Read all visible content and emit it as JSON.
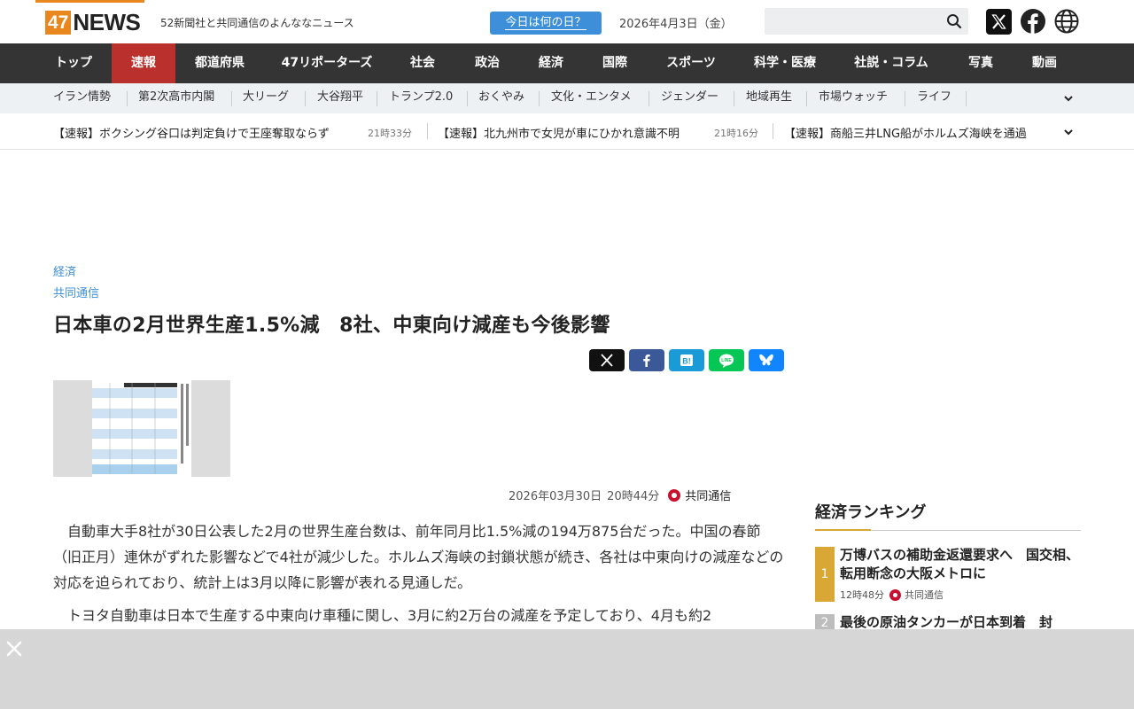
{
  "header": {
    "logo_num": "47",
    "logo_word": "NEWS",
    "tagline": "52新聞社と共同通信のよんななニュース",
    "today_button": "今日は何の日？",
    "date": "2026年4月3日（金）",
    "search_placeholder": ""
  },
  "main_nav": [
    "トップ",
    "速報",
    "都道府県",
    "47リポーターズ",
    "社会",
    "政治",
    "経済",
    "国際",
    "スポーツ",
    "科学・医療",
    "社説・コラム",
    "写真",
    "動画"
  ],
  "topic_nav": [
    "イラン情勢",
    "第2次高市内閣",
    "大リーグ",
    "大谷翔平",
    "トランプ2.0",
    "おくやみ",
    "文化・エンタメ",
    "ジェンダー",
    "地域再生",
    "市場ウォッチ",
    "ライフ"
  ],
  "ticker": [
    {
      "text": "【速報】ボクシング谷口は判定負けで王座奪取ならず",
      "time": "21時33分"
    },
    {
      "text": "【速報】北九州市で女児が車にひかれ意識不明",
      "time": "21時16分"
    },
    {
      "text": "【速報】商船三井LNG船がホルムズ海峡を通過",
      "time": ""
    }
  ],
  "article": {
    "category": "経済",
    "source": "共同通信",
    "headline": "日本車の2月世界生産1.5%減　8社、中東向け減産も今後影響",
    "date": "2026年03月30日",
    "time": "20時44分",
    "provider": "共同通信",
    "paragraphs": [
      "自動車大手8社が30日公表した2月の世界生産台数は、前年同月比1.5%減の194万875台だった。中国の春節（旧正月）連休がずれた影響などで4社が減少した。ホルムズ海峡の封鎖状態が続き、各社は中東向けの減産などの対応を迫られており、統計上は3月以降に影響が表れる見通しだ。",
      "トヨタ自動車は日本で生産する中東向け車種に関し、3月に約2万台の減産を予定しており、4月も約2"
    ]
  },
  "ranking": {
    "heading": "経済ランキング",
    "items": [
      {
        "rank": "1",
        "title": "万博バスの補助金返還要求へ　国交相、転用断念の大阪メトロに",
        "time": "12時48分",
        "source": "共同通信"
      },
      {
        "rank": "2",
        "title": "最後の原油タンカーが日本到着　封",
        "time": "",
        "source": ""
      }
    ]
  },
  "colors": {
    "brand_orange": "#e8871e",
    "nav_dark": "#343434",
    "nav_active": "#b9302c",
    "link_blue": "#3d8fd9",
    "rank_gold": "#d9a834"
  }
}
